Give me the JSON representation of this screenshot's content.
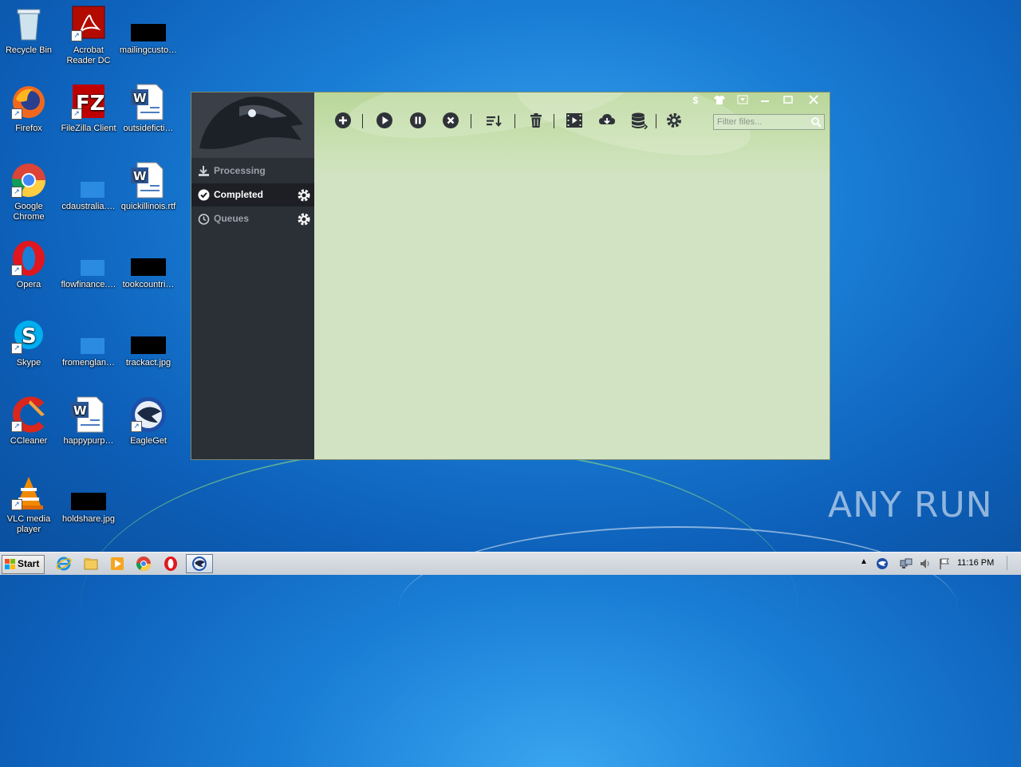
{
  "desktop": {
    "icons": [
      {
        "label": "Recycle Bin",
        "icon": "recycle-bin-icon"
      },
      {
        "label": "Acrobat Reader DC",
        "icon": "acrobat-icon"
      },
      {
        "label": "mailingcusto…",
        "icon": "image-file-icon"
      },
      {
        "label": "Firefox",
        "icon": "firefox-icon"
      },
      {
        "label": "FileZilla Client",
        "icon": "filezilla-icon"
      },
      {
        "label": "outsidefictі…",
        "icon": "word-doc-icon"
      },
      {
        "label": "Google Chrome",
        "icon": "chrome-icon"
      },
      {
        "label": "cdaustralia.…",
        "icon": "blank-file-icon"
      },
      {
        "label": "quickillinois.rtf",
        "icon": "word-doc-icon"
      },
      {
        "label": "Opera",
        "icon": "opera-icon"
      },
      {
        "label": "flowfinance.…",
        "icon": "blank-file-icon"
      },
      {
        "label": "tookcountri…",
        "icon": "image-file-icon"
      },
      {
        "label": "Skype",
        "icon": "skype-icon"
      },
      {
        "label": "fromenglan…",
        "icon": "blank-file-icon"
      },
      {
        "label": "trackact.jpg",
        "icon": "image-file-icon"
      },
      {
        "label": "CCleaner",
        "icon": "ccleaner-icon"
      },
      {
        "label": "happypurp…",
        "icon": "word-doc-icon"
      },
      {
        "label": "EagleGet",
        "icon": "eagleget-icon"
      },
      {
        "label": "VLC media player",
        "icon": "vlc-icon"
      },
      {
        "label": "holdshare.jpg",
        "icon": "image-file-icon"
      }
    ]
  },
  "app": {
    "name": "EagleGet",
    "sidebar": {
      "items": [
        {
          "label": "Processing",
          "icon": "download-icon",
          "active": false
        },
        {
          "label": "Completed",
          "icon": "checkmark-icon",
          "active": true
        },
        {
          "label": "Queues",
          "icon": "clock-icon",
          "active": false
        }
      ]
    },
    "toolbar": {
      "buttons": [
        "add-icon",
        "play-icon",
        "pause-icon",
        "stop-icon",
        "sort-icon",
        "trash-icon",
        "video-icon",
        "cloud-download-icon",
        "database-icon",
        "settings-icon"
      ]
    },
    "filter": {
      "placeholder": "Filter files..."
    },
    "title_controls": [
      "dollar-icon",
      "skin-icon",
      "dropdown-icon",
      "minimize-icon",
      "maximize-icon",
      "close-icon"
    ]
  },
  "taskbar": {
    "start_label": "Start",
    "clock": "11:16 PM"
  },
  "watermark": "ANY RUN"
}
